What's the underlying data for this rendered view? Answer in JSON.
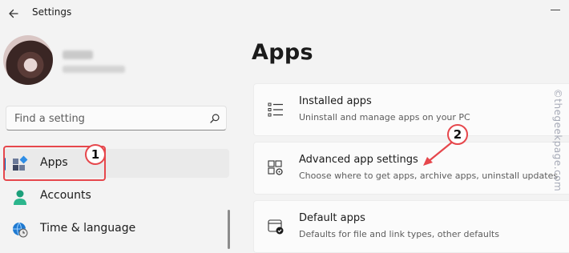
{
  "titlebar": {
    "app_title": "Settings"
  },
  "search": {
    "placeholder": "Find a setting"
  },
  "nav": {
    "apps": "Apps",
    "accounts": "Accounts",
    "time_language": "Time & language"
  },
  "page": {
    "title": "Apps"
  },
  "cards": {
    "installed": {
      "title": "Installed apps",
      "desc": "Uninstall and manage apps on your PC"
    },
    "advanced": {
      "title": "Advanced app settings",
      "desc": "Choose where to get apps, archive apps, uninstall updates"
    },
    "default": {
      "title": "Default apps",
      "desc": "Defaults for file and link types, other defaults"
    }
  },
  "annotations": {
    "step1": "1",
    "step2": "2"
  },
  "watermark": "©thegeekpage.com",
  "colors": {
    "accent": "#005fb8",
    "annotation": "#e6474c"
  },
  "icons": {
    "back": "back-arrow-icon",
    "search": "search-icon",
    "apps": "apps-icon",
    "accounts": "person-icon",
    "time": "globe-clock-icon",
    "installed": "list-icon",
    "advanced": "app-settings-icon",
    "default": "default-apps-icon"
  }
}
